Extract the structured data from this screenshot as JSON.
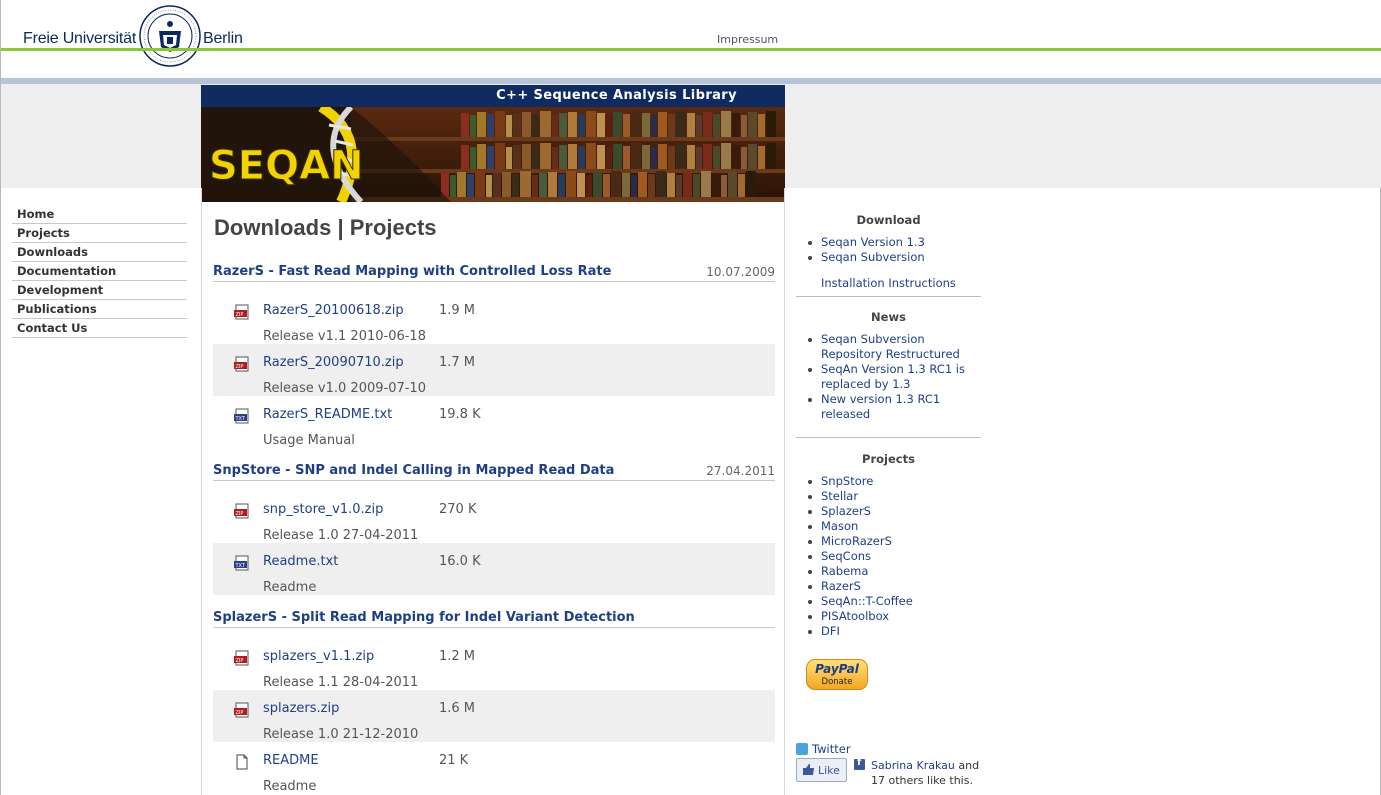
{
  "header": {
    "wordmark_left": "Freie Universität",
    "wordmark_right": "Berlin",
    "seal_text": "VERITAS · IUSTITIA · LIBERTAS · FREIE UNIVERSITÄT BERLIN",
    "impressum": "Impressum"
  },
  "banner": {
    "tagline": "C++ Sequence Analysis Library",
    "logo": "SEQAN"
  },
  "nav": {
    "items": [
      {
        "label": "Home"
      },
      {
        "label": "Projects"
      },
      {
        "label": "Downloads"
      },
      {
        "label": "Documentation"
      },
      {
        "label": "Development"
      },
      {
        "label": "Publications"
      },
      {
        "label": "Contact Us"
      }
    ]
  },
  "content": {
    "title": "Downloads | Projects",
    "sections": [
      {
        "title": "RazerS - Fast Read Mapping with Controlled Loss Rate",
        "date": "10.07.2009",
        "files": [
          {
            "icon": "zip-icon",
            "name": "RazerS_20100618.zip",
            "size": "1.9 M",
            "desc": "Release v1.1 2010-06-18"
          },
          {
            "icon": "zip-icon",
            "name": "RazerS_20090710.zip",
            "size": "1.7 M",
            "desc": "Release v1.0 2009-07-10"
          },
          {
            "icon": "txt-icon",
            "name": "RazerS_README.txt",
            "size": "19.8 K",
            "desc": "Usage Manual"
          }
        ]
      },
      {
        "title": "SnpStore - SNP and Indel Calling in Mapped Read Data",
        "date": "27.04.2011",
        "files": [
          {
            "icon": "zip-icon",
            "name": "snp_store_v1.0.zip",
            "size": "270 K",
            "desc": "Release 1.0 27-04-2011"
          },
          {
            "icon": "txt-icon",
            "name": "Readme.txt",
            "size": "16.0 K",
            "desc": "Readme"
          }
        ]
      },
      {
        "title": "SplazerS - Split Read Mapping for Indel Variant Detection",
        "date": "",
        "files": [
          {
            "icon": "zip-icon",
            "name": "splazers_v1.1.zip",
            "size": "1.2 M",
            "desc": "Release 1.1 28-04-2011"
          },
          {
            "icon": "zip-icon",
            "name": "splazers.zip",
            "size": "1.6 M",
            "desc": "Release 1.0 21-12-2010"
          },
          {
            "icon": "file-icon",
            "name": "README",
            "size": "21 K",
            "desc": "Readme"
          }
        ]
      }
    ]
  },
  "sidebar": {
    "download": {
      "title": "Download",
      "items": [
        {
          "label": "Seqan Version 1.3"
        },
        {
          "label": "Seqan Subversion"
        }
      ],
      "extra_link": "Installation Instructions"
    },
    "news": {
      "title": "News",
      "items": [
        {
          "label": "Seqan Subversion Repository Restructured"
        },
        {
          "label": "SeqAn Version 1.3 RC1 is replaced by 1.3"
        },
        {
          "label": "New version 1.3 RC1 released"
        }
      ]
    },
    "projects": {
      "title": "Projects",
      "items": [
        {
          "label": "SnpStore"
        },
        {
          "label": "Stellar"
        },
        {
          "label": "SplazerS"
        },
        {
          "label": "Mason"
        },
        {
          "label": "MicroRazerS"
        },
        {
          "label": "SeqCons"
        },
        {
          "label": "Rabema"
        },
        {
          "label": "RazerS"
        },
        {
          "label": "SeqAn::T-Coffee"
        },
        {
          "label": "PISAtoolbox"
        },
        {
          "label": "DFI"
        }
      ]
    },
    "paypal": {
      "brand": "PayPal",
      "label": "Donate"
    },
    "twitter": {
      "label": "Twitter"
    },
    "facebook": {
      "like_label": "Like",
      "person": "Sabrina Krakau",
      "rest": "and 17 others like this."
    }
  },
  "colors": {
    "accent_green": "#8cc63f",
    "link_blue": "#1f3f85",
    "banner_navy": "#102b62"
  }
}
